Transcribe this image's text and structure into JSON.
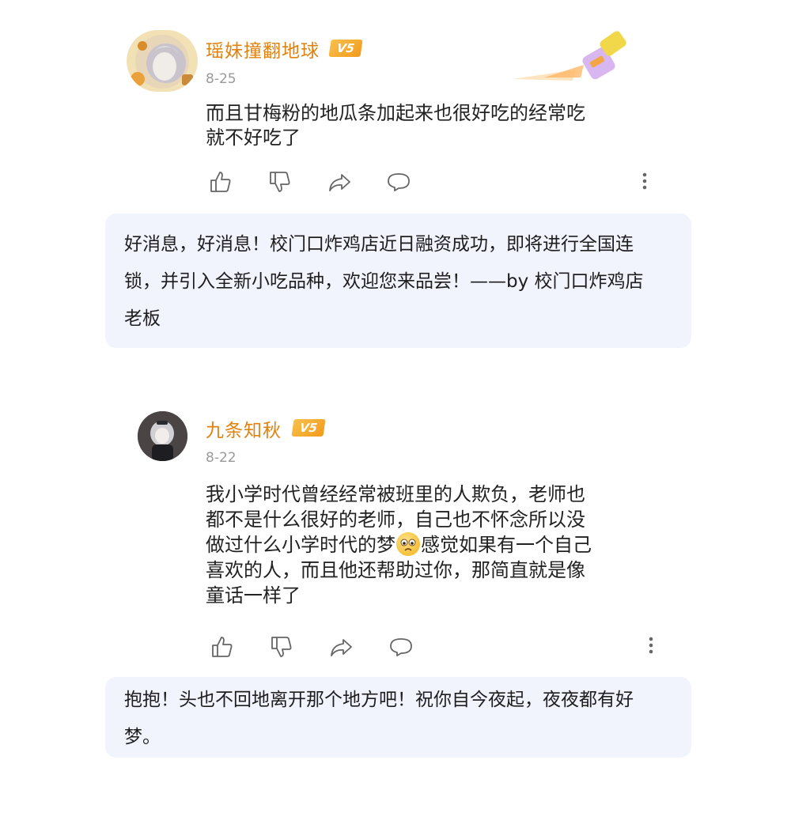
{
  "comments": [
    {
      "username": "瑶妹撞翻地球",
      "vip_label": "V5",
      "date": "8-25",
      "text_lines": [
        "而且甘梅粉的地瓜条加起来也很好吃的经常吃",
        "就不好吃了"
      ]
    },
    {
      "username": "九条知秋",
      "vip_label": "V5",
      "date": "8-22",
      "text_lines": [
        "我小学时代曾经经常被班里的人欺负，老师也",
        "都不是什么很好的老师，自己也不怀念所以没",
        "做过什么小学时代的梦",
        "感觉如果有一个自己",
        "喜欢的人，而且他还帮助过你，那简直就是像",
        "童话一样了"
      ]
    }
  ],
  "replies": [
    {
      "lines": [
        "好消息，好消息！校门口炸鸡店近日融资成功，即将进行全国连",
        "锁，并引入全新小吃品种，欢迎您来品尝！——by 校门口炸鸡店",
        "老板"
      ]
    },
    {
      "lines": [
        "抱抱！头也不回地离开那个地方吧！祝你自今夜起，夜夜都有好",
        "梦。"
      ]
    }
  ],
  "icons": [
    "thumbs-up-icon",
    "thumbs-down-icon",
    "share-icon",
    "comment-icon",
    "more-icon"
  ],
  "colors": {
    "username": "#e0820f",
    "vip": "#f39a1c",
    "reply_bg": "#f1f3fd",
    "icon": "#666666"
  }
}
